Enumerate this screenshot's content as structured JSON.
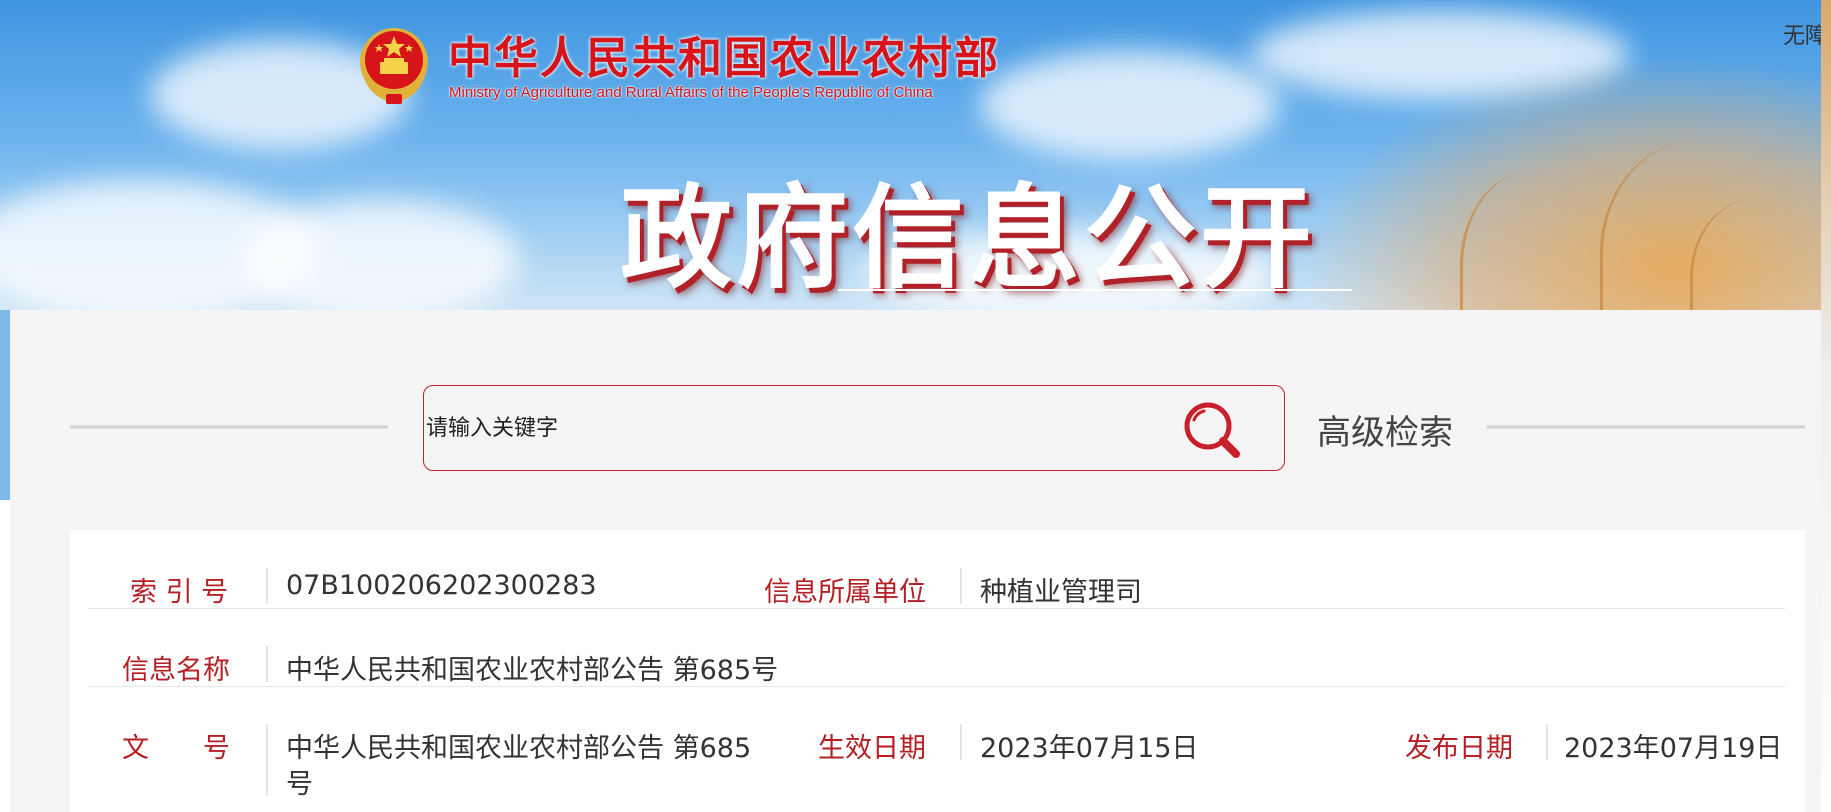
{
  "header": {
    "ministry_name_cn": "中华人民共和国农业农村部",
    "ministry_name_en": "Ministry of Agriculture and Rural Affairs of the People's Republic of China",
    "accessibility_link": "无障",
    "page_title": "政府信息公开",
    "emblem_icon": "national-emblem-icon"
  },
  "search": {
    "placeholder": "请输入关键字",
    "value": "",
    "search_icon": "search-icon",
    "advanced_label": "高级检索"
  },
  "info": {
    "index_label": "索 引 号",
    "index_value": "07B100206202300283",
    "unit_label": "信息所属单位",
    "unit_value": "种植业管理司",
    "name_label": "信息名称",
    "name_value": "中华人民共和国农业农村部公告 第685号",
    "docno_label": "文　　号",
    "docno_value_line1": "中华人民共和国农业农村部公告 第685",
    "docno_value_line2": "号",
    "effective_label": "生效日期",
    "effective_value": "2023年07月15日",
    "publish_label": "发布日期",
    "publish_value": "2023年07月19日"
  },
  "colors": {
    "accent_red": "#b51f24",
    "brand_red": "#d7141a",
    "panel_bg": "#f5f5f5"
  }
}
